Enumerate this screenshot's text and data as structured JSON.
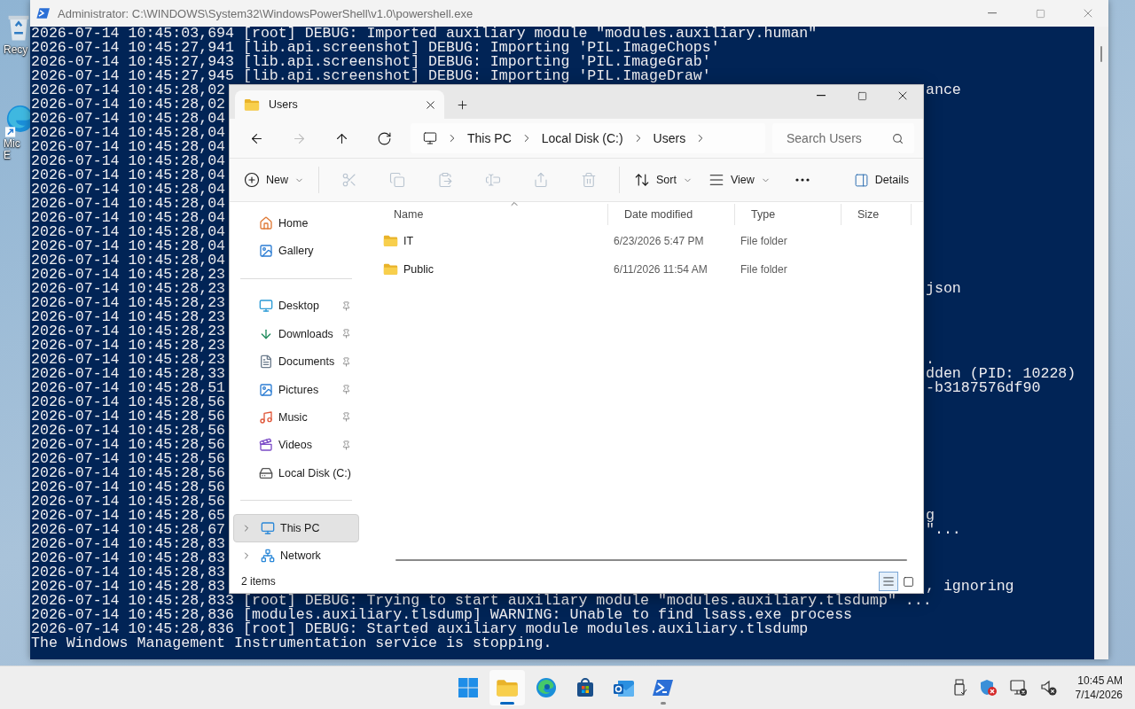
{
  "desktop": {
    "icons": [
      {
        "kind": "recycle",
        "label_lines": [
          "Recy"
        ]
      },
      {
        "kind": "edge",
        "label_lines": [
          "Mic",
          "E"
        ]
      }
    ]
  },
  "console": {
    "title": "Administrator: C:\\WINDOWS\\System32\\WindowsPowerShell\\v1.0\\powershell.exe",
    "lines": [
      {
        "text": "2026-07-14 10:45:03,694 [root] DEBUG: Imported auxiliary module \"modules.auxiliary.human\""
      },
      {
        "text": "2026-07-14 10:45:27,941 [lib.api.screenshot] DEBUG: Importing 'PIL.ImageChops'"
      },
      {
        "text": "2026-07-14 10:45:27,943 [lib.api.screenshot] DEBUG: Importing 'PIL.ImageGrab'"
      },
      {
        "text": "2026-07-14 10:45:27,945 [lib.api.screenshot] DEBUG: Importing 'PIL.ImageDraw'"
      },
      {
        "left": "2026-07-14 10:45:28,02",
        "right": "ance"
      },
      {
        "left": "2026-07-14 10:45:28,02"
      },
      {
        "left": "2026-07-14 10:45:28,04"
      },
      {
        "left": "2026-07-14 10:45:28,04"
      },
      {
        "left": "2026-07-14 10:45:28,04"
      },
      {
        "left": "2026-07-14 10:45:28,04"
      },
      {
        "left": "2026-07-14 10:45:28,04"
      },
      {
        "left": "2026-07-14 10:45:28,04"
      },
      {
        "left": "2026-07-14 10:45:28,04"
      },
      {
        "left": "2026-07-14 10:45:28,04"
      },
      {
        "left": "2026-07-14 10:45:28,04"
      },
      {
        "left": "2026-07-14 10:45:28,04"
      },
      {
        "left": "2026-07-14 10:45:28,04"
      },
      {
        "left": "2026-07-14 10:45:28,23"
      },
      {
        "left": "2026-07-14 10:45:28,23",
        "right": "json"
      },
      {
        "left": "2026-07-14 10:45:28,23"
      },
      {
        "left": "2026-07-14 10:45:28,23"
      },
      {
        "left": "2026-07-14 10:45:28,23"
      },
      {
        "left": "2026-07-14 10:45:28,23"
      },
      {
        "left": "2026-07-14 10:45:28,23",
        "right": "."
      },
      {
        "left": "2026-07-14 10:45:28,33",
        "right": "dden (PID: 10228)"
      },
      {
        "left": "2026-07-14 10:45:28,51",
        "right": "-b3187576df90"
      },
      {
        "left": "2026-07-14 10:45:28,56"
      },
      {
        "left": "2026-07-14 10:45:28,56"
      },
      {
        "left": "2026-07-14 10:45:28,56"
      },
      {
        "left": "2026-07-14 10:45:28,56"
      },
      {
        "left": "2026-07-14 10:45:28,56"
      },
      {
        "left": "2026-07-14 10:45:28,56"
      },
      {
        "left": "2026-07-14 10:45:28,56"
      },
      {
        "left": "2026-07-14 10:45:28,56"
      },
      {
        "left": "2026-07-14 10:45:28,65",
        "right": "g"
      },
      {
        "left": "2026-07-14 10:45:28,67",
        "right": "\"..."
      },
      {
        "left": "2026-07-14 10:45:28,83"
      },
      {
        "left": "2026-07-14 10:45:28,83"
      },
      {
        "left": "2026-07-14 10:45:28,83"
      },
      {
        "left": "2026-07-14 10:45:28,83",
        "right": ", ignoring"
      },
      {
        "text": "2026-07-14 10:45:28,833 [root] DEBUG: Trying to start auxiliary module \"modules.auxiliary.tlsdump\" ..."
      },
      {
        "text": "2026-07-14 10:45:28,836 [modules.auxiliary.tlsdump] WARNING: Unable to find lsass.exe process"
      },
      {
        "text": "2026-07-14 10:45:28,836 [root] DEBUG: Started auxiliary module modules.auxiliary.tlsdump"
      },
      {
        "text": "The Windows Management Instrumentation service is stopping."
      }
    ]
  },
  "explorer": {
    "tab": {
      "title": "Users"
    },
    "nav_buttons": [
      {
        "kind": "back",
        "disabled": false
      },
      {
        "kind": "forward",
        "disabled": true
      },
      {
        "kind": "up",
        "disabled": false
      },
      {
        "kind": "refresh",
        "disabled": false
      }
    ],
    "breadcrumbs": [
      "This PC",
      "Local Disk (C:)",
      "Users"
    ],
    "search": {
      "placeholder": "Search Users"
    },
    "commands": [
      {
        "kind": "new",
        "label": "New",
        "dropdown": true,
        "disabled": false
      },
      {
        "kind": "cut",
        "disabled": true
      },
      {
        "kind": "copy",
        "disabled": true
      },
      {
        "kind": "paste",
        "disabled": true
      },
      {
        "kind": "rename",
        "disabled": true
      },
      {
        "kind": "share",
        "disabled": true
      },
      {
        "kind": "delete",
        "disabled": true
      },
      {
        "kind": "sort",
        "label": "Sort",
        "dropdown": true,
        "disabled": false
      },
      {
        "kind": "view",
        "label": "View",
        "dropdown": true,
        "disabled": false
      },
      {
        "kind": "more",
        "disabled": false
      }
    ],
    "details_button": {
      "label": "Details"
    },
    "nav_sections": [
      {
        "items": [
          {
            "kind": "home",
            "label": "Home",
            "pinned": false,
            "selected": false
          },
          {
            "kind": "gallery",
            "label": "Gallery",
            "pinned": false,
            "selected": false
          }
        ]
      },
      {
        "items": [
          {
            "kind": "desktop",
            "label": "Desktop",
            "pinned": true,
            "selected": false
          },
          {
            "kind": "downloads",
            "label": "Downloads",
            "pinned": true,
            "selected": false
          },
          {
            "kind": "documents",
            "label": "Documents",
            "pinned": true,
            "selected": false
          },
          {
            "kind": "pictures",
            "label": "Pictures",
            "pinned": true,
            "selected": false
          },
          {
            "kind": "music",
            "label": "Music",
            "pinned": true,
            "selected": false
          },
          {
            "kind": "videos",
            "label": "Videos",
            "pinned": true,
            "selected": false
          },
          {
            "kind": "disk",
            "label": "Local Disk (C:)",
            "pinned": false,
            "selected": false
          }
        ]
      },
      {
        "items": [
          {
            "kind": "pc",
            "label": "This PC",
            "pinned": false,
            "selected": true,
            "expanded": false
          },
          {
            "kind": "network",
            "label": "Network",
            "pinned": false,
            "selected": false,
            "expanded": false
          }
        ]
      }
    ],
    "columns": [
      {
        "label": "Name",
        "sorted": true
      },
      {
        "label": "Date modified"
      },
      {
        "label": "Type"
      },
      {
        "label": "Size"
      }
    ],
    "files": [
      {
        "name": "IT",
        "date_modified": "6/23/2026 5:47 PM",
        "type": "File folder"
      },
      {
        "name": "Public",
        "date_modified": "6/11/2026 11:54 AM",
        "type": "File folder"
      }
    ],
    "status": {
      "count": "2 items",
      "views": [
        {
          "kind": "details",
          "selected": true
        },
        {
          "kind": "tiles",
          "selected": false
        }
      ]
    }
  },
  "taskbar": {
    "apps": [
      {
        "kind": "start",
        "selected": false,
        "running": false
      },
      {
        "kind": "explorer",
        "selected": true,
        "running": true
      },
      {
        "kind": "edge",
        "selected": false,
        "running": false
      },
      {
        "kind": "store",
        "selected": false,
        "running": false
      },
      {
        "kind": "outlook",
        "selected": false,
        "running": false
      },
      {
        "kind": "powershell",
        "selected": false,
        "running": true
      }
    ],
    "time": "10:45 AM",
    "date": "7/14/2026"
  }
}
